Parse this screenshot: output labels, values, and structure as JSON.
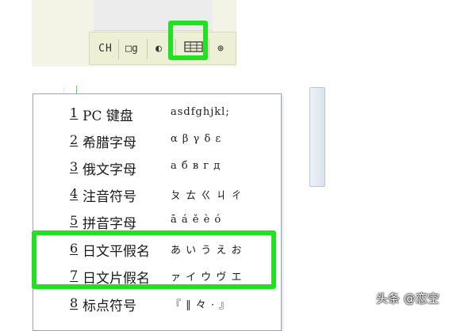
{
  "toolbar": {
    "chinese_mode_label": "CH",
    "punctuation_label": "□g",
    "moon_label": "◐",
    "soft_keyboard_label": "▦",
    "globe_label": "⊕",
    "highlight_color": "#22e022"
  },
  "soft_keyboard_menu": {
    "items": [
      {
        "number": "1",
        "label": "PC 键盘",
        "sample": "asdfghjkl;"
      },
      {
        "number": "2",
        "label": "希腊字母",
        "sample": "α β γ δ ε"
      },
      {
        "number": "3",
        "label": "俄文字母",
        "sample": "а б в г д"
      },
      {
        "number": "4",
        "label": "注音符号",
        "sample": "ㄆ ㄊ ㄍ ㄐ ㄔ"
      },
      {
        "number": "5",
        "label": "拼音字母",
        "sample": "ā á ě è ó"
      },
      {
        "number": "6",
        "label": "日文平假名",
        "sample": "あ い う え お"
      },
      {
        "number": "7",
        "label": "日文片假名",
        "sample": "ァ イ ウ ヴ エ"
      },
      {
        "number": "8",
        "label": "标点符号",
        "sample": "『 ‖ 々 · 』"
      }
    ],
    "highlighted_items": [
      "6",
      "7"
    ]
  },
  "watermark": "头条 @恋空"
}
